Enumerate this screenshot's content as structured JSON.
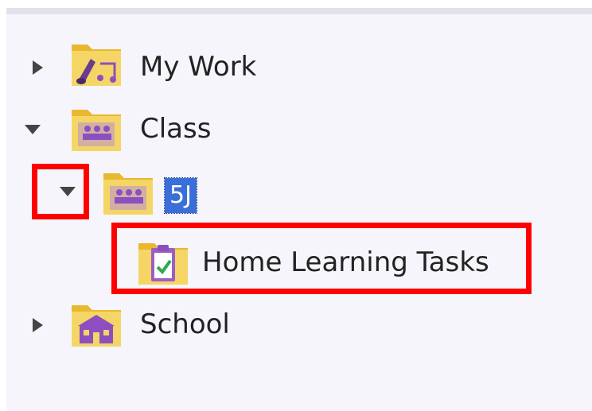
{
  "tree": {
    "items": [
      {
        "label": "My Work",
        "expanded": false,
        "icon": "folder-music-icon"
      },
      {
        "label": "Class",
        "expanded": true,
        "icon": "folder-class-icon"
      },
      {
        "label": "5J",
        "expanded": true,
        "selected": true,
        "icon": "folder-class-icon"
      },
      {
        "label": "Home Learning Tasks",
        "icon": "clipboard-task-icon"
      },
      {
        "label": "School",
        "expanded": false,
        "icon": "school-building-icon"
      }
    ]
  },
  "colors": {
    "highlight": "#ff0000",
    "selection": "#3a6ed8",
    "folder": "#f2cc52",
    "accent_purple": "#8c4fc0"
  }
}
